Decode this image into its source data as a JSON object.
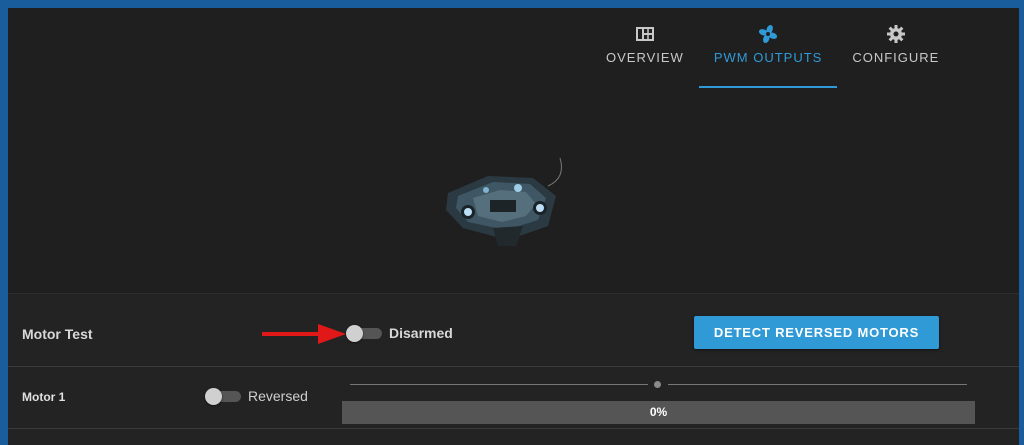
{
  "tabs": [
    {
      "label": "OVERVIEW",
      "icon": "table-icon",
      "active": false
    },
    {
      "label": "PWM OUTPUTS",
      "icon": "fan-icon",
      "active": true
    },
    {
      "label": "CONFIGURE",
      "icon": "gear-icon",
      "active": false
    }
  ],
  "motor_test": {
    "label": "Motor Test",
    "arm_state": "Disarmed",
    "armed": false,
    "detect_button": "DETECT REVERSED MOTORS"
  },
  "motors": [
    {
      "name": "Motor 1",
      "reversed_label": "Reversed",
      "reversed": false,
      "value": "0%",
      "progress": 0
    }
  ],
  "colors": {
    "accent": "#2f9ad6",
    "background": "#1f1f1f",
    "frame": "#1a5d9c",
    "annotation_arrow": "#e01818"
  }
}
